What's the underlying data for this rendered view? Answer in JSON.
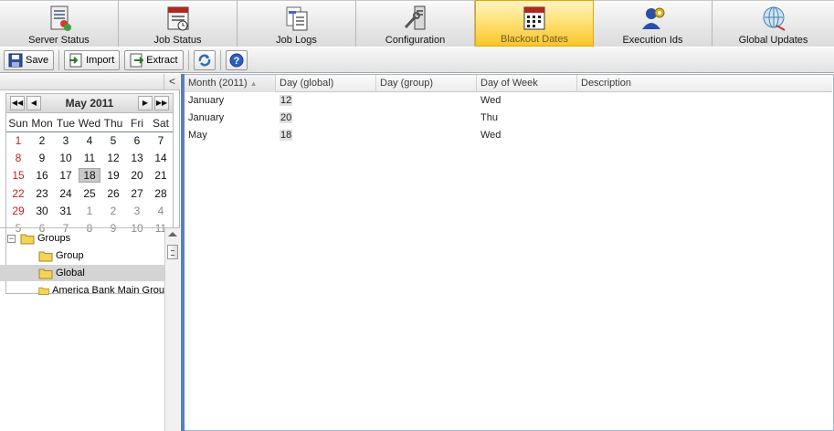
{
  "nav": {
    "tabs": [
      {
        "label": "Server Status",
        "icon": "server-status-icon"
      },
      {
        "label": "Job Status",
        "icon": "job-status-icon"
      },
      {
        "label": "Job Logs",
        "icon": "job-logs-icon"
      },
      {
        "label": "Configuration",
        "icon": "configuration-icon"
      },
      {
        "label": "Blackout Dates",
        "icon": "calendar-icon",
        "active": true
      },
      {
        "label": "Execution Ids",
        "icon": "execution-ids-icon"
      },
      {
        "label": "Global Updates",
        "icon": "global-updates-icon"
      }
    ],
    "active_color": "#f9c52a"
  },
  "toolbar": {
    "save_label": "Save",
    "import_label": "Import",
    "extract_label": "Extract",
    "refresh_icon": "refresh-icon",
    "help_icon": "help-icon"
  },
  "left": {
    "collapse_glyph": "<"
  },
  "calendar": {
    "title": "May 2011",
    "nav": {
      "first": "◀◀",
      "prev": "◀",
      "next": "▶",
      "last": "▶▶"
    },
    "weekdays": [
      "Sun",
      "Mon",
      "Tue",
      "Wed",
      "Thu",
      "Fri",
      "Sat"
    ],
    "weeks": [
      [
        "1",
        "2",
        "3",
        "4",
        "5",
        "6",
        "7"
      ],
      [
        "8",
        "9",
        "10",
        "11",
        "12",
        "13",
        "14"
      ],
      [
        "15",
        "16",
        "17",
        "18",
        "19",
        "20",
        "21"
      ],
      [
        "22",
        "23",
        "24",
        "25",
        "26",
        "27",
        "28"
      ],
      [
        "29",
        "30",
        "31",
        "1",
        "2",
        "3",
        "4"
      ],
      [
        "5",
        "6",
        "7",
        "8",
        "9",
        "10",
        "11"
      ]
    ],
    "today": "18",
    "weekend_color": "#c81e1e"
  },
  "tree": {
    "root": "Groups",
    "root_expander": "−",
    "children": [
      "Group",
      "Global",
      "America Bank Main Grou"
    ],
    "selected": "Global"
  },
  "grid": {
    "columns": [
      "Month (2011)",
      "Day (global)",
      "Day (group)",
      "Day of Week",
      "Description"
    ],
    "sort_glyph": "▲",
    "rows": [
      {
        "month": "January",
        "day_global": "12",
        "day_group": "",
        "day_of_week": "Wed",
        "description": ""
      },
      {
        "month": "January",
        "day_global": "20",
        "day_group": "",
        "day_of_week": "Thu",
        "description": ""
      },
      {
        "month": "May",
        "day_global": "18",
        "day_group": "",
        "day_of_week": "Wed",
        "description": ""
      }
    ]
  }
}
